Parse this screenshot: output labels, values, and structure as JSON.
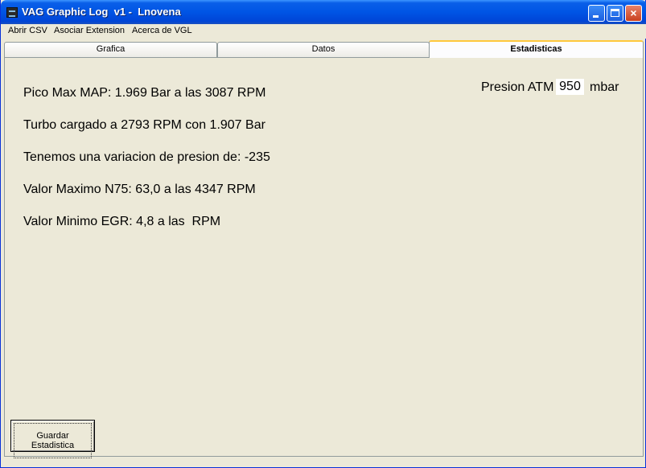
{
  "window": {
    "title": "VAG Graphic Log  v1 -  Lnovena",
    "icon": "app-icon",
    "controls": {
      "minimize": "minimize",
      "maximize": "maximize",
      "close": "×"
    }
  },
  "menu": {
    "items": [
      "Abrir CSV",
      "Asociar Extension",
      "Acerca de VGL"
    ]
  },
  "tabs": [
    {
      "label": "Grafica",
      "active": false
    },
    {
      "label": "Datos",
      "active": false
    },
    {
      "label": "Estadisticas",
      "active": true
    }
  ],
  "stats": {
    "lines": [
      "Pico Max MAP: 1.969 Bar a las 3087 RPM",
      "Turbo cargado a 2793 RPM con 1.907 Bar",
      "Tenemos una variacion de presion de: -235",
      "Valor Maximo N75: 63,0 a las 4347 RPM",
      "Valor Minimo EGR: 4,8 a las  RPM"
    ]
  },
  "atm": {
    "label": "Presion ATM",
    "value": "950",
    "unit": "mbar"
  },
  "actions": {
    "save_label": "Guardar  Estadistica"
  }
}
